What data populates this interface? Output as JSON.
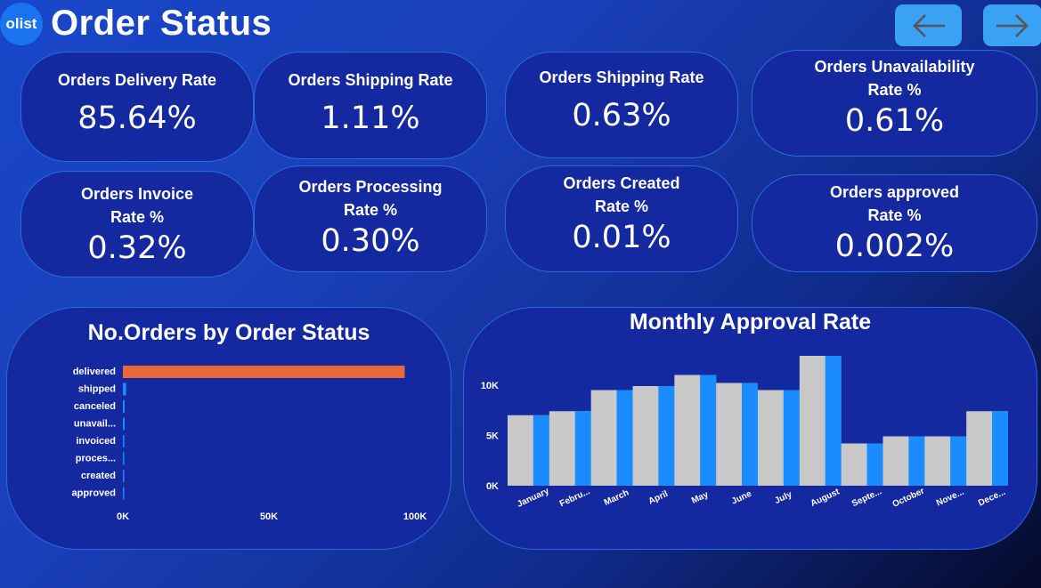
{
  "header": {
    "logo": "olist",
    "title": "Order Status"
  },
  "nav": {
    "back_icon": "arrow-left-icon",
    "forward_icon": "arrow-right-icon"
  },
  "cards": [
    {
      "label": "Orders Delivery Rate",
      "value": "85.64%"
    },
    {
      "label": "Orders Shipping Rate",
      "value": "1.11%"
    },
    {
      "label": "Orders Shipping Rate",
      "value": "0.63%"
    },
    {
      "label": "Orders Unavailability Rate %",
      "value": "0.61%"
    },
    {
      "label": "Orders Invoice Rate %",
      "value": "0.32%"
    },
    {
      "label": "Orders Processing Rate %",
      "value": "0.30%"
    },
    {
      "label": "Orders Created Rate %",
      "value": "0.01%"
    },
    {
      "label": "Orders approved Rate %",
      "value": "0.002%"
    }
  ],
  "colors": {
    "bar_highlight": "#e8683a",
    "bar_default": "#1a8cff",
    "area_fill": "#c8c8c8",
    "card_bg": "#1428a0"
  },
  "chart_data": [
    {
      "type": "bar",
      "orientation": "horizontal",
      "title": "No.Orders by Order Status",
      "categories": [
        "delivered",
        "shipped",
        "canceled",
        "unavail...",
        "invoiced",
        "proces...",
        "created",
        "approved"
      ],
      "values": [
        96478,
        1107,
        625,
        609,
        314,
        301,
        5,
        2
      ],
      "xlim": [
        0,
        100000
      ],
      "xticks": [
        "0K",
        "50K",
        "100K"
      ],
      "grid": false,
      "legend": "none"
    },
    {
      "type": "bar",
      "title": "Monthly Approval Rate",
      "categories": [
        "January",
        "Febru...",
        "March",
        "April",
        "May",
        "June",
        "July",
        "August",
        "Septe...",
        "October",
        "Nove...",
        "Dece..."
      ],
      "values": [
        7000,
        7400,
        9500,
        9900,
        11000,
        10200,
        9500,
        12900,
        4200,
        4900,
        4900,
        7400
      ],
      "area_values": [
        7000,
        7400,
        9500,
        9900,
        11000,
        10200,
        9500,
        12900,
        4200,
        4900,
        4900,
        7400
      ],
      "ylim": [
        0,
        12900
      ],
      "yticks": [
        "0K",
        "5K",
        "10K"
      ],
      "grid": false,
      "legend": "none"
    }
  ]
}
